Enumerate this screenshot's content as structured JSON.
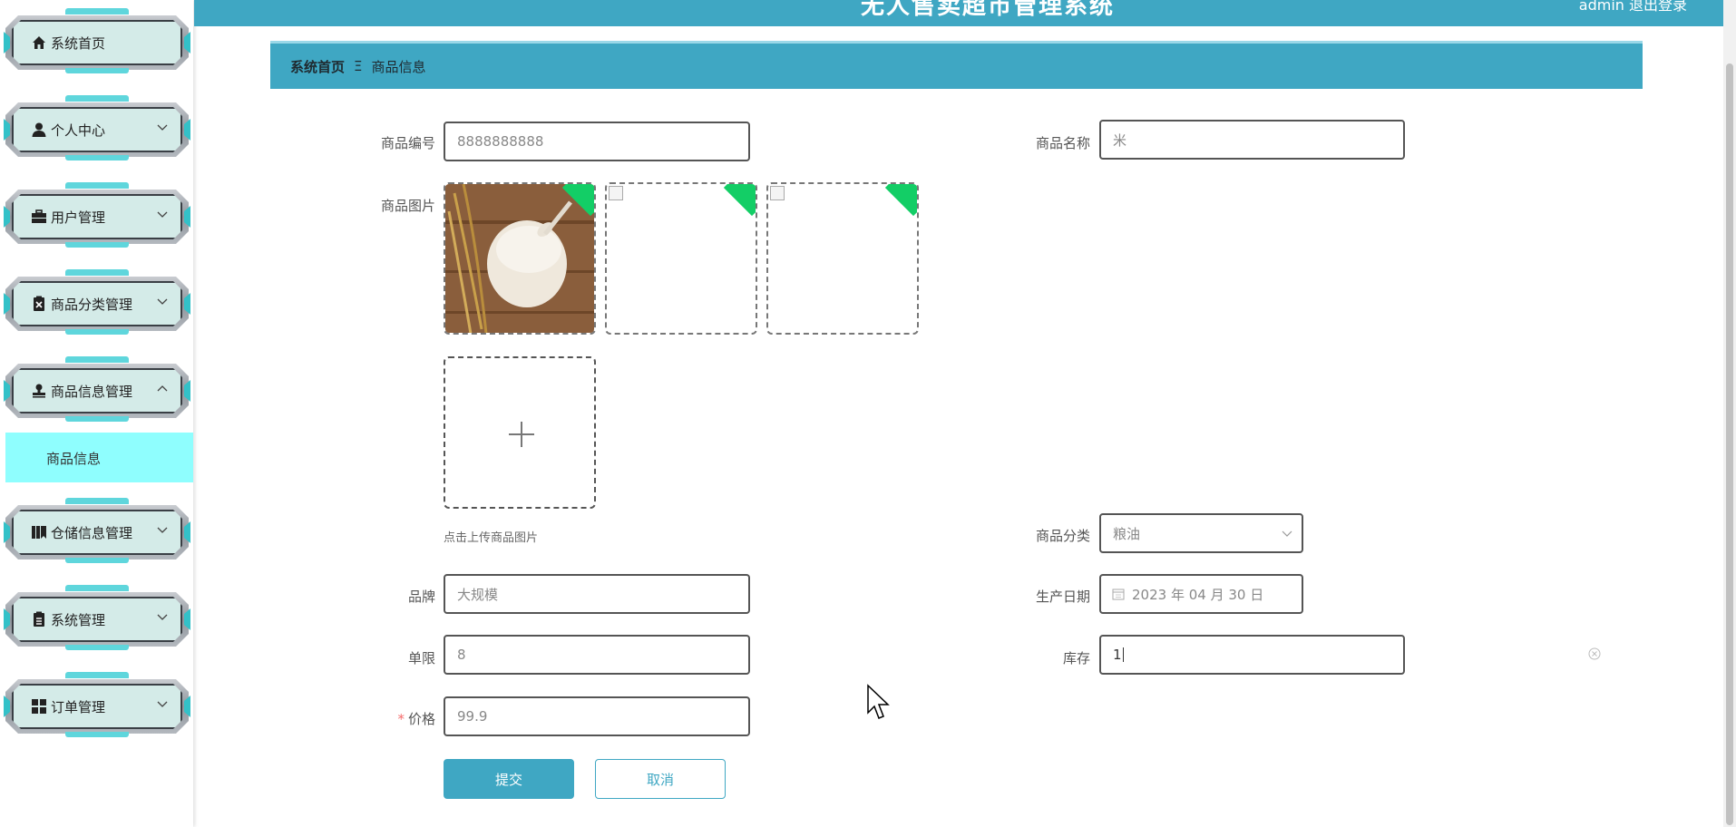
{
  "header": {
    "title": "无人售卖超市管理系统",
    "user": "admin  退出登录"
  },
  "sidebar": {
    "items": [
      {
        "label": "系统首页",
        "icon": "home-icon"
      },
      {
        "label": "个人中心",
        "icon": "user-icon"
      },
      {
        "label": "用户管理",
        "icon": "briefcase-icon"
      },
      {
        "label": "商品分类管理",
        "icon": "clipboard-x-icon"
      },
      {
        "label": "商品信息管理",
        "icon": "stamp-icon"
      },
      {
        "label": "仓储信息管理",
        "icon": "book-icon"
      },
      {
        "label": "系统管理",
        "icon": "clipboard-icon"
      },
      {
        "label": "订单管理",
        "icon": "grid-icon"
      }
    ],
    "submenu_label": "商品信息"
  },
  "breadcrumb": {
    "home": "系统首页",
    "separator": "Ξ",
    "current": "商品信息"
  },
  "form": {
    "code_label": "商品编号",
    "code_value": "8888888888",
    "name_label": "商品名称",
    "name_value": "米",
    "image_label": "商品图片",
    "upload_hint": "点击上传商品图片",
    "category_label": "商品分类",
    "category_value": "粮油",
    "brand_label": "品牌",
    "brand_value": "大规模",
    "date_label": "生产日期",
    "date_value": "2023 年 04 月 30 日",
    "limit_label": "单限",
    "limit_value": "8",
    "stock_label": "库存",
    "stock_value": "1",
    "price_required": "*",
    "price_label": "价格",
    "price_value": "99.9"
  },
  "buttons": {
    "submit": "提交",
    "cancel": "取消"
  },
  "colors": {
    "accent": "#3fa7c3",
    "submenu": "#8ffefe",
    "upload_corner": "#13ce66"
  }
}
